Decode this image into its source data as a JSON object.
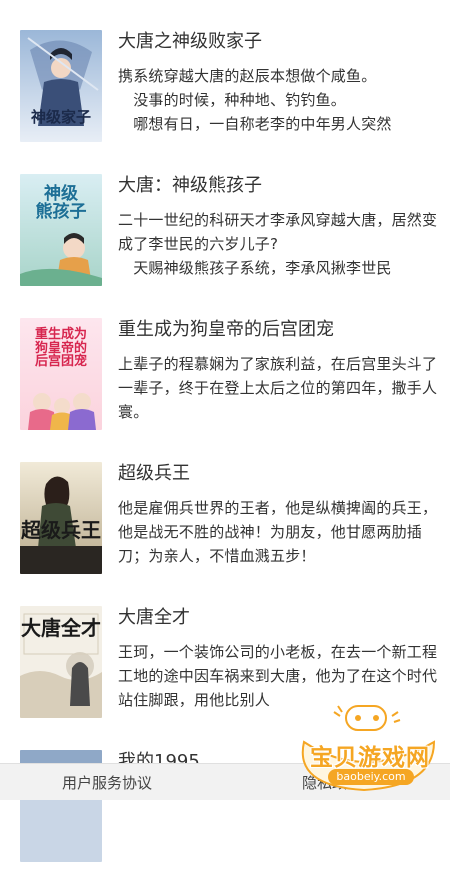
{
  "books": [
    {
      "title": "大唐之神级败家子",
      "desc": "携系统穿越大唐的赵辰本想做个咸鱼。\n　没事的时候，种种地、钓钓鱼。\n　哪想有日，一自称老李的中年男人突然",
      "cover_icon": "book-cover-swordsman"
    },
    {
      "title": "大唐：神级熊孩子",
      "desc": "二十一世纪的科研天才李承风穿越大唐，居然变成了李世民的六岁儿子?\n　天赐神级熊孩子系统，李承风揪李世民",
      "cover_icon": "book-cover-child"
    },
    {
      "title": "重生成为狗皇帝的后宫团宠",
      "desc": "上辈子的程慕娴为了家族利益，在后宫里头斗了一辈子，终于在登上太后之位的第四年，撒手人寰。",
      "cover_icon": "book-cover-palace"
    },
    {
      "title": "超级兵王",
      "desc": "他是雇佣兵世界的王者，他是纵横捭阖的兵王，他是战无不胜的战神！为朋友，他甘愿两肋插刀；为亲人，不惜血溅五步！",
      "cover_icon": "book-cover-soldier"
    },
    {
      "title": "大唐全才",
      "desc": "王珂，一个装饰公司的小老板，在去一个新工程工地的途中因车祸来到大唐，他为了在这个时代站住脚跟，用他比别人",
      "cover_icon": "book-cover-calligraphy"
    },
    {
      "title": "我的1995",
      "desc": "",
      "cover_icon": "book-cover-generic"
    }
  ],
  "footer": {
    "terms_label": "用户服务协议",
    "privacy_label": "隐私政策"
  },
  "watermark": {
    "text": "宝贝游戏网",
    "url": "baobeiy.com"
  }
}
